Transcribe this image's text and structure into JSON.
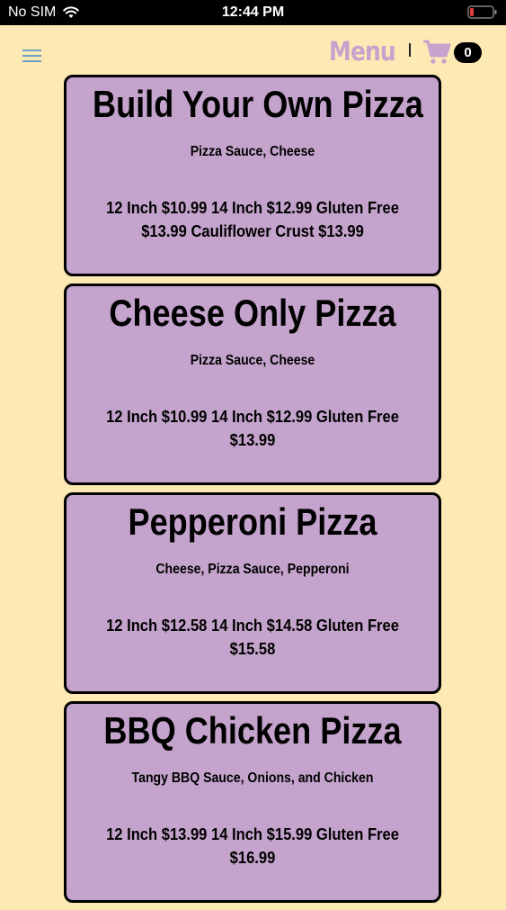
{
  "status_bar": {
    "carrier": "No SIM",
    "time": "12:44 PM",
    "wifi_icon": "wifi-icon",
    "battery_icon": "battery-icon"
  },
  "header": {
    "menu_icon": "hamburger-icon",
    "title": "Menu",
    "cart_icon": "cart-icon",
    "cart_count": "0",
    "accent_color": "#c6a2cc"
  },
  "colors": {
    "background": "#fce9b4",
    "card": "#c4a3cc",
    "card_border": "#000000"
  },
  "items": [
    {
      "name": "Build Your Own Pizza",
      "description": "Pizza Sauce, Cheese",
      "prices": "12 Inch $10.99   14 Inch $12.99   Gluten Free $13.99   Cauliflower Crust $13.99"
    },
    {
      "name": "Cheese Only Pizza",
      "description": "Pizza Sauce, Cheese",
      "prices": "12 Inch $10.99   14 Inch $12.99   Gluten Free $13.99"
    },
    {
      "name": "Pepperoni Pizza",
      "description": "Cheese, Pizza Sauce, Pepperoni",
      "prices": "12 Inch $12.58   14 Inch $14.58   Gluten Free $15.58"
    },
    {
      "name": "BBQ Chicken Pizza",
      "description": "Tangy BBQ Sauce, Onions, and Chicken",
      "prices": "12 Inch $13.99   14 Inch $15.99   Gluten Free $16.99"
    }
  ]
}
